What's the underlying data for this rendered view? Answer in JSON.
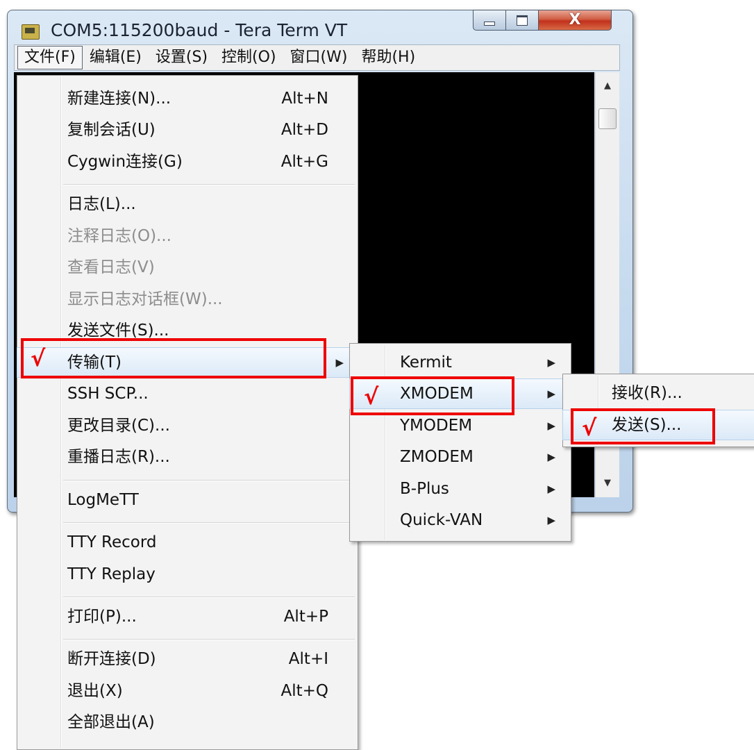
{
  "window": {
    "title": "COM5:115200baud - Tera Term VT",
    "close_glyph": "X",
    "icons": {
      "app": "tera-term-app-icon",
      "minimize": "minimize-icon",
      "maximize": "maximize-icon",
      "close": "close-icon"
    }
  },
  "menubar": {
    "items": [
      "文件(F)",
      "编辑(E)",
      "设置(S)",
      "控制(O)",
      "窗口(W)",
      "帮助(H)"
    ],
    "active": "文件(F)"
  },
  "scrollbar": {
    "up_glyph": "▲",
    "down_glyph": "▼"
  },
  "file_menu": {
    "items": [
      {
        "label": "新建连接(N)...",
        "shortcut": "Alt+N"
      },
      {
        "label": "复制会话(U)",
        "shortcut": "Alt+D"
      },
      {
        "label": "Cygwin连接(G)",
        "shortcut": "Alt+G"
      },
      {
        "label": "日志(L)..."
      },
      {
        "label": "注释日志(O)...",
        "disabled": true
      },
      {
        "label": "查看日志(V)",
        "disabled": true
      },
      {
        "label": "显示日志对话框(W)...",
        "disabled": true
      },
      {
        "label": "发送文件(S)..."
      },
      {
        "label": "传输(T)",
        "submenu_arrow": "▶",
        "highlighted": true
      },
      {
        "label": "SSH SCP..."
      },
      {
        "label": "更改目录(C)..."
      },
      {
        "label": "重播日志(R)..."
      },
      {
        "label": "LogMeTT"
      },
      {
        "label": "TTY Record"
      },
      {
        "label": "TTY Replay"
      },
      {
        "label": "打印(P)...",
        "shortcut": "Alt+P"
      },
      {
        "label": "断开连接(D)",
        "shortcut": "Alt+I"
      },
      {
        "label": "退出(X)",
        "shortcut": "Alt+Q"
      },
      {
        "label": "全部退出(A)"
      }
    ]
  },
  "transfer_menu": {
    "items": [
      {
        "label": "Kermit",
        "arrow": "▶"
      },
      {
        "label": "XMODEM",
        "arrow": "▶",
        "highlighted": true
      },
      {
        "label": "YMODEM",
        "arrow": "▶"
      },
      {
        "label": "ZMODEM",
        "arrow": "▶"
      },
      {
        "label": "B-Plus",
        "arrow": "▶"
      },
      {
        "label": "Quick-VAN",
        "arrow": "▶"
      }
    ]
  },
  "xmodem_menu": {
    "items": [
      {
        "label": "接收(R)..."
      },
      {
        "label": "发送(S)...",
        "highlighted": true
      }
    ]
  },
  "annotations": {
    "check_mark": "√",
    "color": "#ee0000"
  }
}
